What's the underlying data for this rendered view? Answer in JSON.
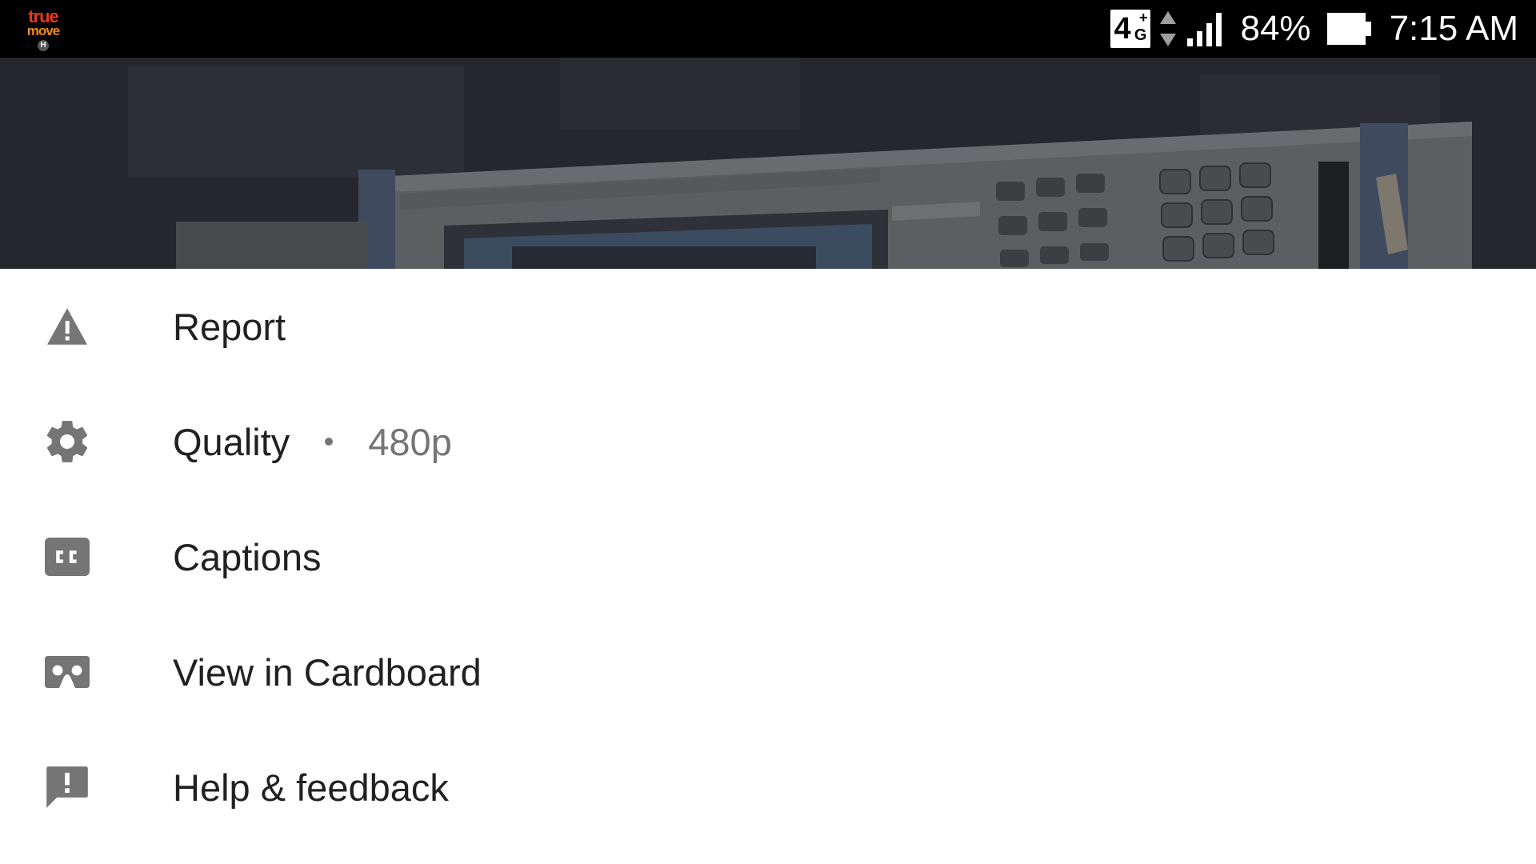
{
  "status_bar": {
    "carrier_line1": "true",
    "carrier_line2": "move",
    "carrier_line3": "H",
    "network_type": "4",
    "network_plus": "+",
    "network_g": "G",
    "battery_percent": "84%",
    "time": "7:15 AM",
    "icons": [
      "carrier-logo",
      "network-4g-icon",
      "data-activity-icon",
      "signal-icon",
      "battery-icon"
    ]
  },
  "menu": {
    "items": [
      {
        "label": "Report",
        "icon": "warning-icon"
      },
      {
        "label": "Quality",
        "value": "480p",
        "icon": "gear-icon"
      },
      {
        "label": "Captions",
        "icon": "captions-icon"
      },
      {
        "label": "View in Cardboard",
        "icon": "cardboard-icon"
      },
      {
        "label": "Help & feedback",
        "icon": "feedback-icon"
      }
    ]
  },
  "colors": {
    "status_bar_bg": "#000000",
    "sheet_bg": "#ffffff",
    "icon_gray": "#757575",
    "text_primary": "#212121",
    "text_secondary": "#757575"
  }
}
